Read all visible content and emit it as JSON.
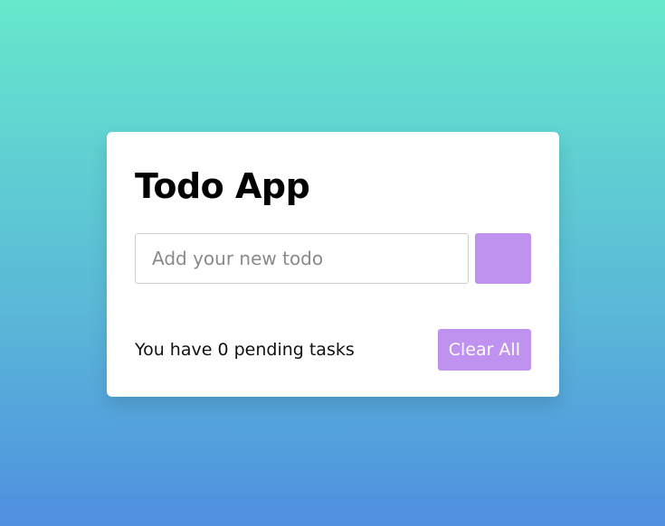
{
  "app": {
    "title": "Todo App"
  },
  "form": {
    "input": {
      "value": "",
      "placeholder": "Add your new todo"
    },
    "add_button": {
      "label": ""
    }
  },
  "footer": {
    "pending_prefix": "You have ",
    "pending_count": "0",
    "pending_suffix": " pending tasks",
    "clear_label": "Clear All"
  },
  "colors": {
    "accent": "#bf92f0",
    "background_top": "#66e8cc",
    "background_bottom": "#4f8fe0"
  }
}
